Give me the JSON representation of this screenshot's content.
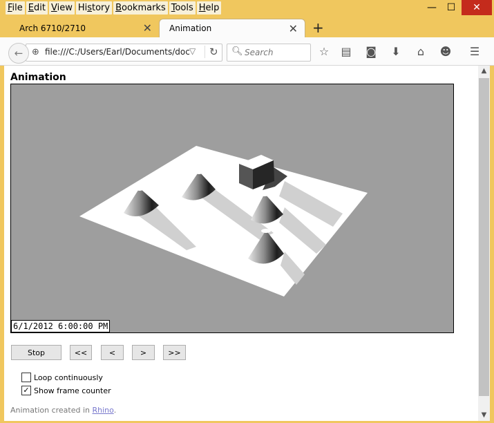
{
  "menu": [
    {
      "pre": "",
      "u": "F",
      "post": "ile"
    },
    {
      "pre": "",
      "u": "E",
      "post": "dit"
    },
    {
      "pre": "",
      "u": "V",
      "post": "iew"
    },
    {
      "pre": "Hi",
      "u": "s",
      "post": "tory"
    },
    {
      "pre": "",
      "u": "B",
      "post": "ookmarks"
    },
    {
      "pre": "",
      "u": "T",
      "post": "ools"
    },
    {
      "pre": "",
      "u": "H",
      "post": "elp"
    }
  ],
  "window": {
    "minimize": "—",
    "maximize": "☐",
    "close": "✕"
  },
  "tabs": [
    {
      "label": "Arch 6710/2710"
    },
    {
      "label": "Animation"
    }
  ],
  "tab_close": "✕",
  "new_tab": "+",
  "nav": {
    "back": "←",
    "url": "file:///C:/Users/Earl/Documents/docs/",
    "reload": "↻",
    "search_placeholder": "Search"
  },
  "toolbar_icons": [
    "star-icon",
    "reading-list-icon",
    "pocket-icon",
    "download-icon",
    "home-icon",
    "smiley-icon",
    "menu-icon"
  ],
  "page": {
    "title": "Animation",
    "frame_counter": "6/1/2012 6:00:00 PM",
    "buttons": {
      "stop": "Stop",
      "first": "<<",
      "prev": "<",
      "next": ">",
      "last": ">>"
    },
    "loop_label": "Loop continuously",
    "loop_checked": false,
    "counter_label": "Show frame counter",
    "counter_checked": true,
    "footer_prefix": "Animation created in ",
    "footer_link": "Rhino",
    "footer_suffix": "."
  }
}
